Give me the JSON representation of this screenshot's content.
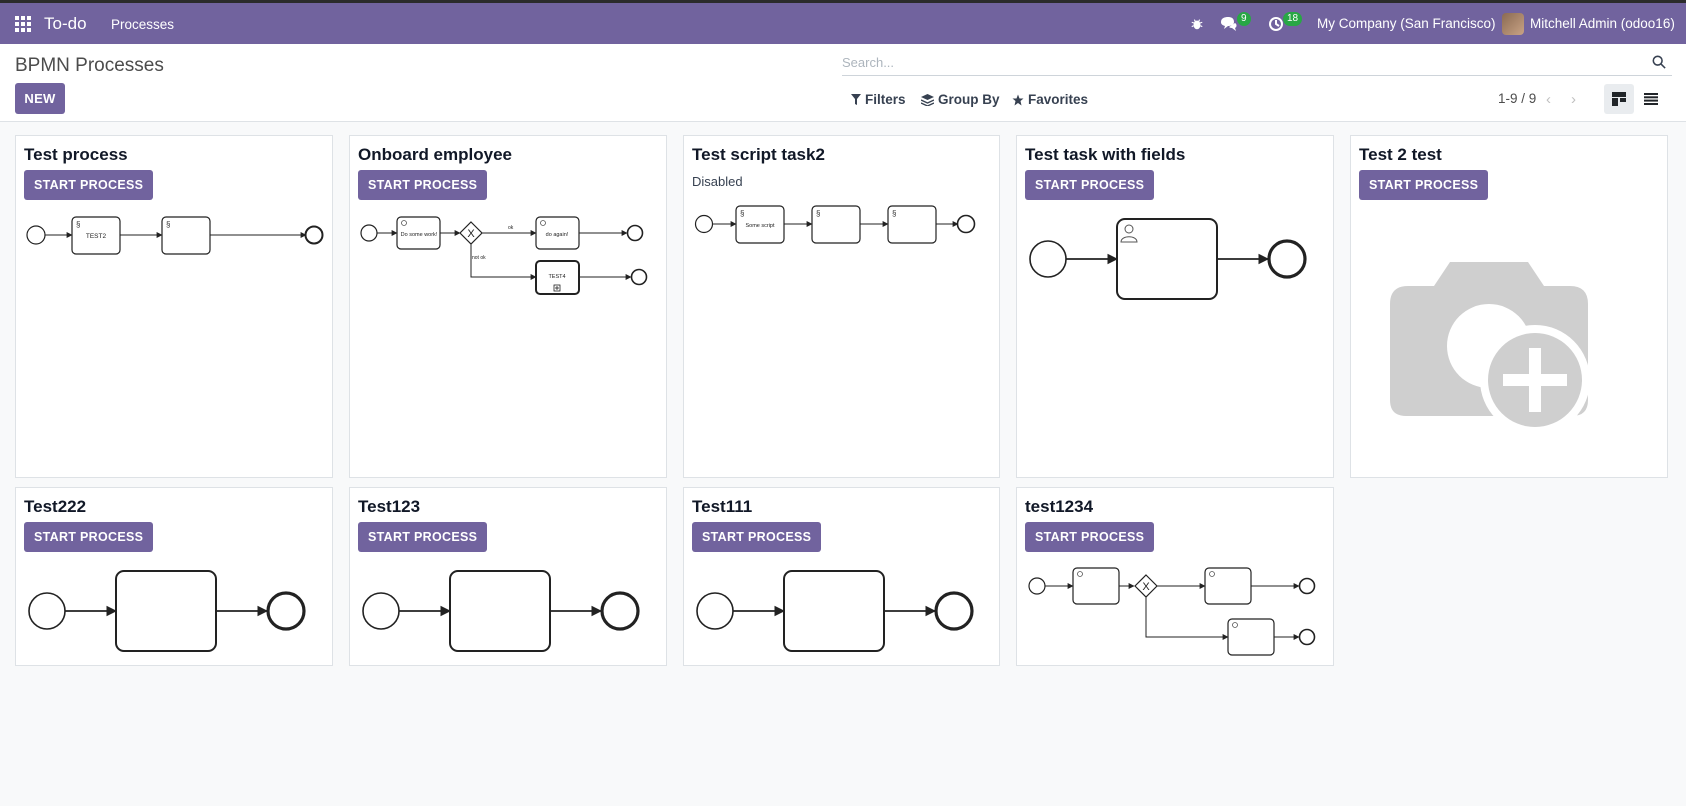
{
  "navbar": {
    "app_name": "To-do",
    "menu_processes": "Processes",
    "messages_count": "9",
    "activities_count": "18",
    "company": "My Company (San Francisco)",
    "user": "Mitchell Admin (odoo16)",
    "bg_color": "#71639e"
  },
  "control": {
    "title": "BPMN Processes",
    "new_label": "NEW",
    "search_placeholder": "Search...",
    "filters_label": "Filters",
    "groupby_label": "Group By",
    "favorites_label": "Favorites",
    "pager": "1-9 / 9",
    "active_view": "kanban"
  },
  "cards": [
    {
      "title": "Test process",
      "button": "START PROCESS",
      "task1": "TEST2"
    },
    {
      "title": "Onboard employee",
      "button": "START PROCESS",
      "task1": "Do some work!",
      "task2": "do again!",
      "task3": "TEST4",
      "flow_ok": "ok",
      "flow_notok": "not ok"
    },
    {
      "title": "Test script task2",
      "status": "Disabled",
      "task1": "Some script"
    },
    {
      "title": "Test task with fields",
      "button": "START PROCESS"
    },
    {
      "title": "Test 2 test",
      "button": "START PROCESS"
    },
    {
      "title": "Test222",
      "button": "START PROCESS"
    },
    {
      "title": "Test123",
      "button": "START PROCESS"
    },
    {
      "title": "Test111",
      "button": "START PROCESS"
    },
    {
      "title": "test1234",
      "button": "START PROCESS"
    }
  ]
}
